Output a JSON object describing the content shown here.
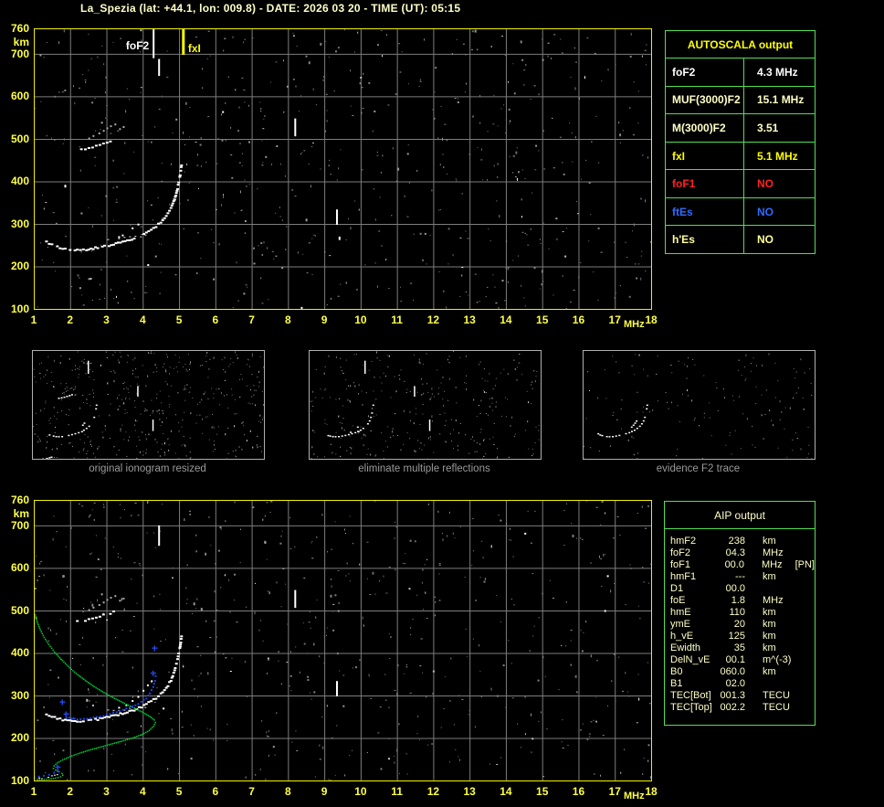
{
  "window": {
    "title": "La_Spezia (lat: +44.1, lon: 009.8) - DATE: 2026 03 20 - TIME (UT): 05:15"
  },
  "colors": {
    "background": "#000000",
    "title_text": "#ffffc8",
    "axis_text": "#ffff44",
    "plot_border": "#f0f000",
    "grid": "#7d7d7d",
    "table_border": "#55dd55",
    "autoscala_header": "#ffff00",
    "aip_text": "#ffffc8",
    "caption_text": "#9a9a9a",
    "trace_white": "#ffffff",
    "profile_green": "#00d234",
    "fitted_blue": "#2244ee",
    "marker_foF2": "#ffffff",
    "marker_fxI": "#ffff00",
    "thumb_border": "#b0b0b0"
  },
  "autoscala_table": {
    "title": "AUTOSCALA output",
    "rows": [
      {
        "label": "foF2",
        "value": "4.3 MHz",
        "color": "#ffffff"
      },
      {
        "label": "MUF(3000)F2",
        "value": "15.1 MHz",
        "color": "#ffffc8"
      },
      {
        "label": "M(3000)F2",
        "value": "3.51",
        "color": "#ffffc8"
      },
      {
        "label": "fxI",
        "value": "5.1 MHz",
        "color": "#ffff00"
      },
      {
        "label": "foF1",
        "value": "NO",
        "color": "#ff2222"
      },
      {
        "label": "ftEs",
        "value": "NO",
        "color": "#2e6bff"
      },
      {
        "label": "h'Es",
        "value": "NO",
        "color": "#ffff99"
      }
    ]
  },
  "aip_table": {
    "title": "AIP output",
    "rows": [
      {
        "label": "hmF2",
        "value": "238",
        "unit": "km",
        "extra": ""
      },
      {
        "label": "foF2",
        "value": "04.3",
        "unit": "MHz",
        "extra": ""
      },
      {
        "label": "foF1",
        "value": "00.0",
        "unit": "MHz",
        "extra": "[PN]"
      },
      {
        "label": "hmF1",
        "value": "---",
        "unit": "km",
        "extra": ""
      },
      {
        "label": "D1",
        "value": "00.0",
        "unit": "",
        "extra": ""
      },
      {
        "label": "foE",
        "value": "1.8",
        "unit": "MHz",
        "extra": ""
      },
      {
        "label": "hmE",
        "value": "110",
        "unit": "km",
        "extra": ""
      },
      {
        "label": "ymE",
        "value": "20",
        "unit": "km",
        "extra": ""
      },
      {
        "label": "h_vE",
        "value": "125",
        "unit": "km",
        "extra": ""
      },
      {
        "label": "Ewidth",
        "value": "35",
        "unit": "km",
        "extra": ""
      },
      {
        "label": "DelN_vE",
        "value": "00.1",
        "unit": "m^(-3)",
        "extra": ""
      },
      {
        "label": "B0",
        "value": "060.0",
        "unit": "km",
        "extra": ""
      },
      {
        "label": "B1",
        "value": "02.0",
        "unit": "",
        "extra": ""
      },
      {
        "label": "TEC[Bot]",
        "value": "001.3",
        "unit": "TECU",
        "extra": ""
      },
      {
        "label": "TEC[Top]",
        "value": "002.2",
        "unit": "TECU",
        "extra": ""
      }
    ]
  },
  "thumbnails": [
    {
      "caption": "original ionogram resized",
      "noise": 430,
      "seed": 303,
      "traces": [
        "main",
        "o_branch",
        "flat",
        "second_hop",
        "e_layer"
      ],
      "dashes": true
    },
    {
      "caption": "eliminate multiple reflections",
      "noise": 310,
      "seed": 404,
      "traces": [
        "main",
        "o_branch",
        "flat"
      ],
      "dashes": true
    },
    {
      "caption": "evidence F2 trace",
      "noise": 150,
      "seed": 505,
      "traces": [
        "main",
        "o_branch"
      ],
      "dashes": false
    }
  ],
  "chart_data": {
    "plots": [
      {
        "id": "top_ionogram",
        "type": "scatter",
        "title": "measured ionogram with AUTOSCALA markers",
        "xlabel": "MHz",
        "ylabel": "km",
        "xlim": [
          1,
          18
        ],
        "ylim": [
          100,
          760
        ],
        "grid": true,
        "xticks": [
          1,
          2,
          3,
          4,
          5,
          6,
          7,
          8,
          9,
          10,
          11,
          12,
          13,
          14,
          15,
          16,
          17,
          18
        ],
        "yticks": [
          760,
          700,
          600,
          500,
          400,
          300,
          200,
          100
        ],
        "seed": 101,
        "noise": 620,
        "traces": [
          "main",
          "o_branch",
          "flat",
          "second_hop"
        ],
        "gray_cluster": true,
        "echo_dashes": [
          [
            4.45,
            648,
            688
          ],
          [
            8.2,
            506,
            548
          ],
          [
            9.35,
            298,
            334
          ],
          [
            9.42,
            262,
            270
          ]
        ],
        "markers": [
          {
            "name": "foF2",
            "freq": 4.3,
            "value_mhz": 4.3,
            "label": "foF2",
            "line_to_km": 692,
            "side": "left"
          },
          {
            "name": "fxI",
            "freq": 5.12,
            "value_mhz": 5.1,
            "label": "fxI",
            "line_to_km": 700,
            "side": "right"
          }
        ]
      },
      {
        "id": "reconstructed_ionogram",
        "type": "scatter",
        "title": "ionogram with fitted trace and electron density profile",
        "xlabel": "MHz",
        "ylabel": "km",
        "xlim": [
          1,
          18
        ],
        "ylim": [
          100,
          760
        ],
        "grid": true,
        "xticks": [
          1,
          2,
          3,
          4,
          5,
          6,
          7,
          8,
          9,
          10,
          11,
          12,
          13,
          14,
          15,
          16,
          17,
          18
        ],
        "yticks": [
          760,
          700,
          600,
          500,
          400,
          300,
          200,
          100
        ],
        "seed": 202,
        "noise": 600,
        "traces": [
          "main",
          "o_branch",
          "flat",
          "second_hop",
          "e_layer"
        ],
        "gray_cluster": true,
        "echo_dashes": [
          [
            4.45,
            652,
            700
          ],
          [
            8.2,
            506,
            548
          ],
          [
            9.35,
            298,
            334
          ]
        ],
        "markers": [],
        "profile": "profile_green",
        "fitted": [
          "fitted_blue_f",
          "fitted_blue_e"
        ],
        "crosses": "fitted_crosses"
      }
    ],
    "traces": {
      "main": [
        [
          1.35,
          257
        ],
        [
          1.5,
          250
        ],
        [
          1.65,
          246
        ],
        [
          1.8,
          243
        ],
        [
          2.0,
          240
        ],
        [
          2.2,
          239
        ],
        [
          2.45,
          240
        ],
        [
          2.7,
          243
        ],
        [
          2.95,
          247
        ],
        [
          3.2,
          252
        ],
        [
          3.45,
          258
        ],
        [
          3.7,
          264
        ],
        [
          3.9,
          271
        ],
        [
          4.1,
          279
        ],
        [
          4.3,
          290
        ],
        [
          4.5,
          303
        ],
        [
          4.65,
          318
        ],
        [
          4.78,
          336
        ],
        [
          4.88,
          358
        ],
        [
          4.96,
          384
        ],
        [
          5.02,
          410
        ],
        [
          5.06,
          432
        ],
        [
          5.08,
          446
        ]
      ],
      "o_branch": [
        [
          3.35,
          271
        ],
        [
          3.55,
          279
        ],
        [
          3.72,
          288
        ],
        [
          3.88,
          298
        ],
        [
          4.02,
          310
        ],
        [
          4.14,
          322
        ],
        [
          4.25,
          335
        ],
        [
          4.33,
          348
        ]
      ],
      "flat": [
        [
          3.05,
          265
        ],
        [
          3.35,
          266
        ],
        [
          3.65,
          268
        ],
        [
          3.95,
          270
        ],
        [
          4.2,
          273
        ]
      ],
      "second_hop": [
        [
          2.2,
          474
        ],
        [
          2.42,
          477
        ],
        [
          2.62,
          481
        ],
        [
          2.82,
          486
        ],
        [
          3.02,
          491
        ],
        [
          3.2,
          496
        ],
        [
          3.35,
          501
        ]
      ],
      "e_layer": [
        [
          1.0,
          102
        ],
        [
          1.15,
          104
        ],
        [
          1.3,
          106
        ],
        [
          1.5,
          110
        ],
        [
          1.65,
          114
        ],
        [
          1.73,
          118
        ]
      ],
      "hop_cluster": [
        [
          2.62,
          509
        ],
        [
          2.78,
          515
        ],
        [
          2.9,
          521
        ],
        [
          3.0,
          527
        ],
        [
          3.1,
          532
        ],
        [
          3.22,
          536
        ],
        [
          2.85,
          540
        ],
        [
          3.35,
          525
        ],
        [
          2.5,
          503
        ],
        [
          3.45,
          530
        ]
      ],
      "profile_green": [
        [
          1.02,
          491
        ],
        [
          1.08,
          473
        ],
        [
          1.16,
          456
        ],
        [
          1.27,
          438
        ],
        [
          1.4,
          421
        ],
        [
          1.55,
          404
        ],
        [
          1.73,
          387
        ],
        [
          1.93,
          370
        ],
        [
          2.15,
          353
        ],
        [
          2.4,
          337
        ],
        [
          2.65,
          322
        ],
        [
          2.92,
          308
        ],
        [
          3.2,
          295
        ],
        [
          3.48,
          283
        ],
        [
          3.75,
          272
        ],
        [
          4.0,
          261
        ],
        [
          4.18,
          252
        ],
        [
          4.3,
          244
        ],
        [
          4.33,
          238
        ],
        [
          4.28,
          229
        ],
        [
          4.16,
          219
        ],
        [
          3.97,
          210
        ],
        [
          3.72,
          202
        ],
        [
          3.45,
          195
        ],
        [
          3.15,
          188
        ],
        [
          2.85,
          181
        ],
        [
          2.55,
          174
        ],
        [
          2.25,
          166
        ],
        [
          1.98,
          158
        ],
        [
          1.78,
          150
        ],
        [
          1.63,
          143
        ],
        [
          1.54,
          136
        ],
        [
          1.52,
          130
        ],
        [
          1.58,
          126
        ],
        [
          1.68,
          122
        ],
        [
          1.76,
          118
        ],
        [
          1.78,
          114
        ],
        [
          1.72,
          110
        ],
        [
          1.58,
          107
        ],
        [
          1.4,
          105
        ],
        [
          1.2,
          104
        ],
        [
          1.03,
          104
        ]
      ],
      "fitted_blue_f": [
        [
          1.9,
          244
        ],
        [
          2.05,
          241
        ],
        [
          2.2,
          239
        ],
        [
          2.38,
          240
        ],
        [
          2.56,
          242
        ],
        [
          2.74,
          245
        ],
        [
          2.92,
          248
        ],
        [
          3.1,
          252
        ],
        [
          3.28,
          257
        ],
        [
          3.46,
          262
        ],
        [
          3.64,
          267
        ],
        [
          3.8,
          273
        ],
        [
          3.96,
          280
        ],
        [
          4.1,
          289
        ],
        [
          4.2,
          300
        ],
        [
          4.29,
          315
        ],
        [
          4.34,
          331
        ],
        [
          4.37,
          350
        ]
      ],
      "fitted_blue_e": [
        [
          1.02,
          103
        ],
        [
          1.14,
          104
        ],
        [
          1.28,
          106
        ],
        [
          1.42,
          109
        ],
        [
          1.56,
          113
        ],
        [
          1.68,
          117
        ],
        [
          1.74,
          120
        ]
      ],
      "fitted_crosses": [
        [
          1.78,
          285
        ],
        [
          1.88,
          257
        ],
        [
          4.32,
          412
        ],
        [
          4.28,
          353
        ],
        [
          1.65,
          132
        ]
      ]
    }
  }
}
